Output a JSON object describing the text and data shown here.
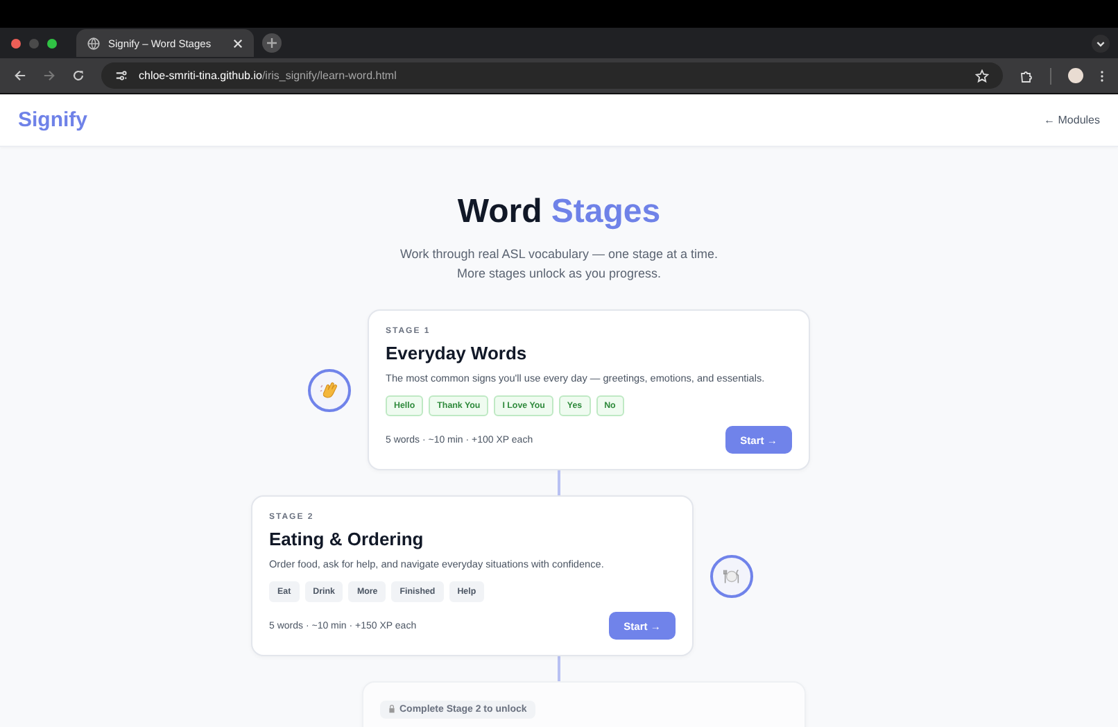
{
  "browser": {
    "tab_title": "Signify – Word Stages",
    "url_domain": "chloe-smriti-tina.github.io",
    "url_path": "/iris_signify/learn-word.html"
  },
  "header": {
    "logo": "Signify",
    "back_link": "← Modules"
  },
  "hero": {
    "title_dark": "Word",
    "title_accent": "Stages",
    "subtitle_lines": [
      "Work through real ASL vocabulary — one stage at a time.",
      "More stages unlock as you progress."
    ]
  },
  "stages": [
    {
      "kind": "open",
      "label": "STAGE 1",
      "title": "Everyday Words",
      "description": "The most common signs you'll use every day — greetings, emotions, and essentials.",
      "tags": [
        {
          "text": "Hello",
          "learned": true
        },
        {
          "text": "Thank You",
          "learned": true
        },
        {
          "text": "I Love You",
          "learned": true
        },
        {
          "text": "Yes",
          "learned": true
        },
        {
          "text": "No",
          "learned": true
        }
      ],
      "meta": "5 words · ~10 min · +100 XP each",
      "button": "Start →"
    },
    {
      "kind": "open",
      "label": "STAGE 2",
      "title": "Eating & Ordering",
      "description": "Order food, ask for help, and navigate everyday situations with confidence.",
      "tags": [
        {
          "text": "Eat",
          "learned": false
        },
        {
          "text": "Drink",
          "learned": false
        },
        {
          "text": "More",
          "learned": false
        },
        {
          "text": "Finished",
          "learned": false
        },
        {
          "text": "Help",
          "learned": false
        }
      ],
      "meta": "5 words · ~10 min · +150 XP each",
      "button": "Start →"
    },
    {
      "kind": "locked",
      "lock_text": "Complete Stage 2 to unlock"
    }
  ]
}
